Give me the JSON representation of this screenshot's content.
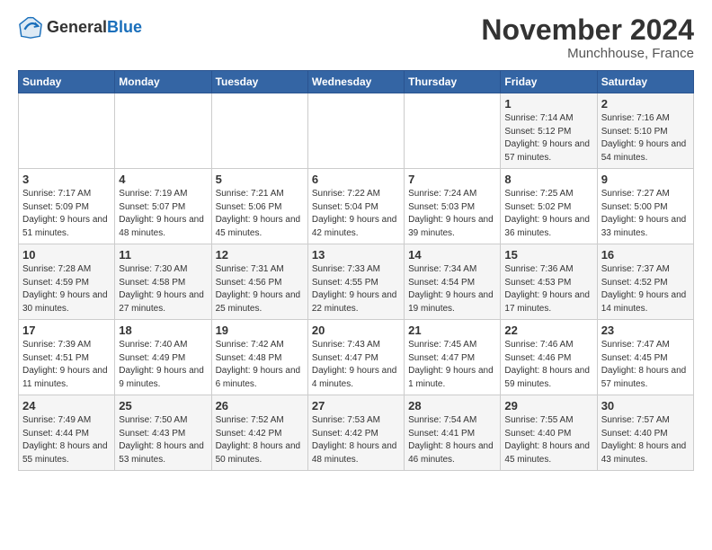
{
  "logo": {
    "general": "General",
    "blue": "Blue"
  },
  "title": "November 2024",
  "subtitle": "Munchhouse, France",
  "header_days": [
    "Sunday",
    "Monday",
    "Tuesday",
    "Wednesday",
    "Thursday",
    "Friday",
    "Saturday"
  ],
  "weeks": [
    [
      {
        "day": "",
        "info": ""
      },
      {
        "day": "",
        "info": ""
      },
      {
        "day": "",
        "info": ""
      },
      {
        "day": "",
        "info": ""
      },
      {
        "day": "",
        "info": ""
      },
      {
        "day": "1",
        "info": "Sunrise: 7:14 AM\nSunset: 5:12 PM\nDaylight: 9 hours and 57 minutes."
      },
      {
        "day": "2",
        "info": "Sunrise: 7:16 AM\nSunset: 5:10 PM\nDaylight: 9 hours and 54 minutes."
      }
    ],
    [
      {
        "day": "3",
        "info": "Sunrise: 7:17 AM\nSunset: 5:09 PM\nDaylight: 9 hours and 51 minutes."
      },
      {
        "day": "4",
        "info": "Sunrise: 7:19 AM\nSunset: 5:07 PM\nDaylight: 9 hours and 48 minutes."
      },
      {
        "day": "5",
        "info": "Sunrise: 7:21 AM\nSunset: 5:06 PM\nDaylight: 9 hours and 45 minutes."
      },
      {
        "day": "6",
        "info": "Sunrise: 7:22 AM\nSunset: 5:04 PM\nDaylight: 9 hours and 42 minutes."
      },
      {
        "day": "7",
        "info": "Sunrise: 7:24 AM\nSunset: 5:03 PM\nDaylight: 9 hours and 39 minutes."
      },
      {
        "day": "8",
        "info": "Sunrise: 7:25 AM\nSunset: 5:02 PM\nDaylight: 9 hours and 36 minutes."
      },
      {
        "day": "9",
        "info": "Sunrise: 7:27 AM\nSunset: 5:00 PM\nDaylight: 9 hours and 33 minutes."
      }
    ],
    [
      {
        "day": "10",
        "info": "Sunrise: 7:28 AM\nSunset: 4:59 PM\nDaylight: 9 hours and 30 minutes."
      },
      {
        "day": "11",
        "info": "Sunrise: 7:30 AM\nSunset: 4:58 PM\nDaylight: 9 hours and 27 minutes."
      },
      {
        "day": "12",
        "info": "Sunrise: 7:31 AM\nSunset: 4:56 PM\nDaylight: 9 hours and 25 minutes."
      },
      {
        "day": "13",
        "info": "Sunrise: 7:33 AM\nSunset: 4:55 PM\nDaylight: 9 hours and 22 minutes."
      },
      {
        "day": "14",
        "info": "Sunrise: 7:34 AM\nSunset: 4:54 PM\nDaylight: 9 hours and 19 minutes."
      },
      {
        "day": "15",
        "info": "Sunrise: 7:36 AM\nSunset: 4:53 PM\nDaylight: 9 hours and 17 minutes."
      },
      {
        "day": "16",
        "info": "Sunrise: 7:37 AM\nSunset: 4:52 PM\nDaylight: 9 hours and 14 minutes."
      }
    ],
    [
      {
        "day": "17",
        "info": "Sunrise: 7:39 AM\nSunset: 4:51 PM\nDaylight: 9 hours and 11 minutes."
      },
      {
        "day": "18",
        "info": "Sunrise: 7:40 AM\nSunset: 4:49 PM\nDaylight: 9 hours and 9 minutes."
      },
      {
        "day": "19",
        "info": "Sunrise: 7:42 AM\nSunset: 4:48 PM\nDaylight: 9 hours and 6 minutes."
      },
      {
        "day": "20",
        "info": "Sunrise: 7:43 AM\nSunset: 4:47 PM\nDaylight: 9 hours and 4 minutes."
      },
      {
        "day": "21",
        "info": "Sunrise: 7:45 AM\nSunset: 4:47 PM\nDaylight: 9 hours and 1 minute."
      },
      {
        "day": "22",
        "info": "Sunrise: 7:46 AM\nSunset: 4:46 PM\nDaylight: 8 hours and 59 minutes."
      },
      {
        "day": "23",
        "info": "Sunrise: 7:47 AM\nSunset: 4:45 PM\nDaylight: 8 hours and 57 minutes."
      }
    ],
    [
      {
        "day": "24",
        "info": "Sunrise: 7:49 AM\nSunset: 4:44 PM\nDaylight: 8 hours and 55 minutes."
      },
      {
        "day": "25",
        "info": "Sunrise: 7:50 AM\nSunset: 4:43 PM\nDaylight: 8 hours and 53 minutes."
      },
      {
        "day": "26",
        "info": "Sunrise: 7:52 AM\nSunset: 4:42 PM\nDaylight: 8 hours and 50 minutes."
      },
      {
        "day": "27",
        "info": "Sunrise: 7:53 AM\nSunset: 4:42 PM\nDaylight: 8 hours and 48 minutes."
      },
      {
        "day": "28",
        "info": "Sunrise: 7:54 AM\nSunset: 4:41 PM\nDaylight: 8 hours and 46 minutes."
      },
      {
        "day": "29",
        "info": "Sunrise: 7:55 AM\nSunset: 4:40 PM\nDaylight: 8 hours and 45 minutes."
      },
      {
        "day": "30",
        "info": "Sunrise: 7:57 AM\nSunset: 4:40 PM\nDaylight: 8 hours and 43 minutes."
      }
    ]
  ]
}
